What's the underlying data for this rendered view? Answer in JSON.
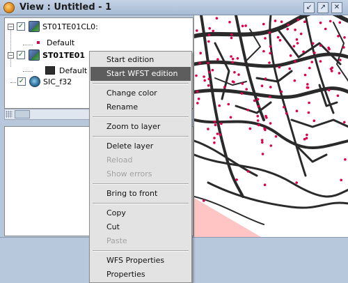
{
  "window": {
    "title": "View : Untitled - 1",
    "app_icon": "gvsig-icon",
    "controls": [
      "minimize-icon",
      "maximize-icon",
      "close-icon"
    ]
  },
  "toc": {
    "layers": [
      {
        "name": "ST01TE01CL0:",
        "visible": true,
        "expanded": true,
        "bold": false,
        "legend": {
          "label": "Default",
          "symbol": "point",
          "color": "#e0004a"
        }
      },
      {
        "name": "ST01TE01",
        "visible": true,
        "expanded": true,
        "bold": true,
        "legend": {
          "label": "Default",
          "symbol": "fill",
          "color": "#2e2e2e"
        }
      },
      {
        "name": "SIC_f32",
        "visible": true,
        "expanded": false,
        "bold": false
      }
    ]
  },
  "context_menu": {
    "items": [
      {
        "label": "Start edition",
        "state": "normal"
      },
      {
        "label": "Start WFST edition",
        "state": "selected"
      },
      {
        "separator": true
      },
      {
        "label": "Change color",
        "state": "normal"
      },
      {
        "label": "Rename",
        "state": "normal"
      },
      {
        "separator": true
      },
      {
        "label": "Zoom to layer",
        "state": "normal"
      },
      {
        "separator": true
      },
      {
        "label": "Delete layer",
        "state": "normal"
      },
      {
        "label": "Reload",
        "state": "disabled"
      },
      {
        "label": "Show errors",
        "state": "disabled"
      },
      {
        "separator": true
      },
      {
        "label": "Bring to front",
        "state": "normal"
      },
      {
        "separator": true
      },
      {
        "label": "Copy",
        "state": "normal"
      },
      {
        "label": "Cut",
        "state": "normal"
      },
      {
        "label": "Paste",
        "state": "disabled"
      },
      {
        "separator": true
      },
      {
        "label": "WFS Properties",
        "state": "normal"
      },
      {
        "label": "Properties",
        "state": "normal"
      }
    ]
  },
  "colors": {
    "road": "#2a2a2a",
    "point": "#e0004a",
    "area_fill": "#ffc4c4",
    "menu_bg": "#e3e3e3",
    "menu_selected": "#5d5d5d",
    "titlebar": "#b4c6de"
  }
}
